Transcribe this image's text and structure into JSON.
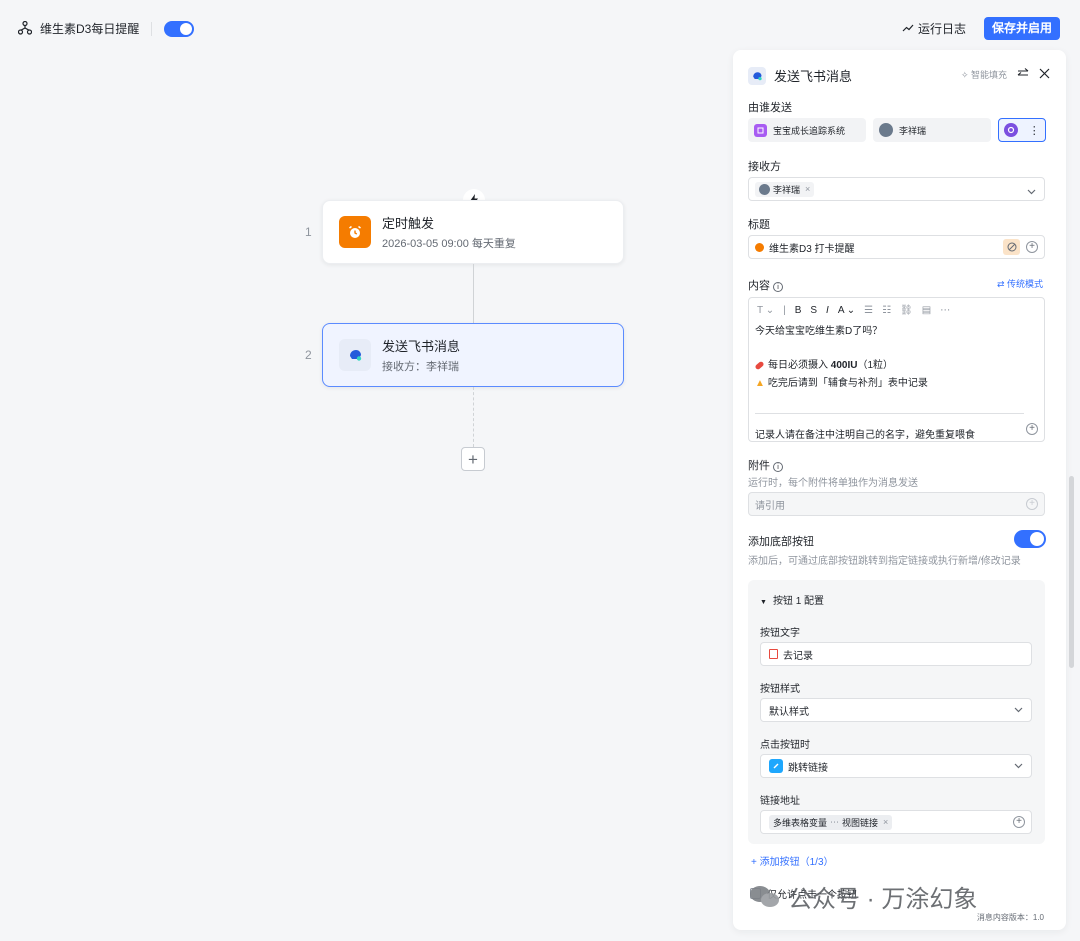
{
  "header": {
    "workflow_name": "维生素D3每日提醒",
    "log_label": "运行日志",
    "save_label": "保存并启用"
  },
  "canvas": {
    "nodes": [
      {
        "num": "1",
        "title": "定时触发",
        "subtitle": "2026-03-05 09:00 每天重复"
      },
      {
        "num": "2",
        "title": "发送飞书消息",
        "subtitle": "接收方：李祥瑞"
      }
    ],
    "add_symbol": "+"
  },
  "panel": {
    "title": "发送飞书消息",
    "smart_fill": "✧ 智能填充",
    "sender_label": "由谁发送",
    "sender_app": "宝宝成长追踪系统",
    "sender_user": "李祥瑞",
    "receiver_label": "接收方",
    "receiver_tag": "李祥瑞",
    "title_label": "标题",
    "title_value": "维生素D3 打卡提醒",
    "content_label": "内容",
    "classic_mode": "⇄ 传统模式",
    "toolbar": [
      "T ⌄",
      "|",
      "B",
      "S",
      "I",
      "A ⌄",
      "☰",
      "☷",
      "⛓",
      "▤",
      "⋯"
    ],
    "content_line1": "今天给宝宝吃维生素D了吗？",
    "content_line2_pre": "每日必须摄入 ",
    "content_line2_bold": "400IU",
    "content_line2_post": "（1粒）",
    "content_line3": "吃完后请到「辅食与补剂」表中记录",
    "content_footer": "记录人请在备注中注明自己的名字，避免重复喂食",
    "attach_label": "附件",
    "attach_desc": "运行时，每个附件将单独作为消息发送",
    "attach_placeholder": "请引用",
    "bottom_btn_label": "添加底部按钮",
    "bottom_btn_desc": "添加后，可通过底部按钮跳转到指定链接或执行新增/修改记录",
    "button_config": {
      "header": "按钮 1 配置",
      "text_label": "按钮文字",
      "text_value": "去记录",
      "style_label": "按钮样式",
      "style_value": "默认样式",
      "click_label": "点击按钮时",
      "click_value": "跳转链接",
      "url_label": "链接地址",
      "url_tag1": "多维表格变量",
      "url_tag2": "视图链接"
    },
    "add_button": "+ 添加按钮（1/3）",
    "only_once": "仅允许点击一个按钮",
    "version": "消息内容版本：1.0"
  },
  "watermark": {
    "text": "公众号 · 万涂幻象"
  },
  "colors": {
    "primary": "#3370ff",
    "trigger_orange": "#f57c00",
    "selected_bg": "#f0f4ff"
  }
}
